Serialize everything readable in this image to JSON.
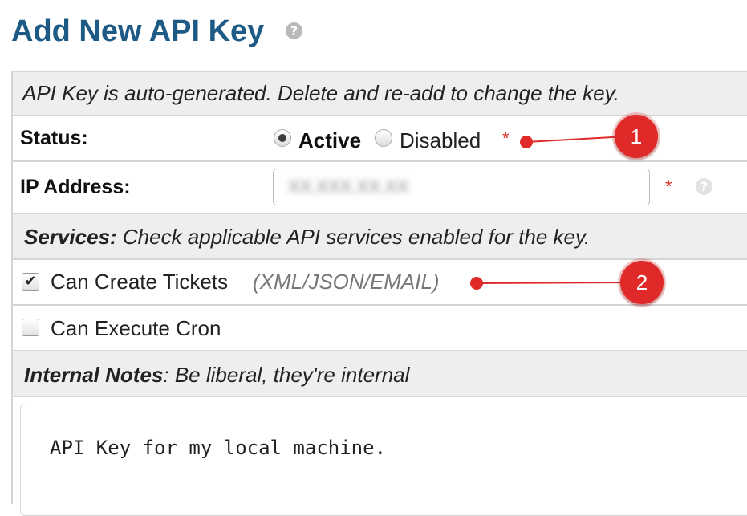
{
  "header": {
    "title": "Add New API Key",
    "help_icon": "?"
  },
  "form": {
    "info_banner": "API Key is auto-generated. Delete and re-add to change the key.",
    "status": {
      "label": "Status:",
      "options": [
        {
          "label": "Active",
          "selected": true
        },
        {
          "label": "Disabled",
          "selected": false
        }
      ],
      "required_mark": "*"
    },
    "ip_address": {
      "label": "IP Address:",
      "value": "XX.XXX.XX.XX",
      "required_mark": "*",
      "help_icon": "?"
    },
    "services": {
      "heading": "Services:",
      "description": " Check applicable API services enabled for the key.",
      "items": [
        {
          "label": "Can Create Tickets",
          "hint": "(XML/JSON/EMAIL)",
          "checked": true
        },
        {
          "label": "Can Execute Cron",
          "hint": "",
          "checked": false
        }
      ]
    },
    "internal_notes": {
      "heading": "Internal Notes",
      "description": ": Be liberal, they're internal",
      "value": "API Key for my local machine."
    }
  },
  "annotations": [
    {
      "number": "1"
    },
    {
      "number": "2"
    }
  ],
  "colors": {
    "title": "#1e5a86",
    "annotation": "#e02a2a",
    "required": "#d93025"
  }
}
